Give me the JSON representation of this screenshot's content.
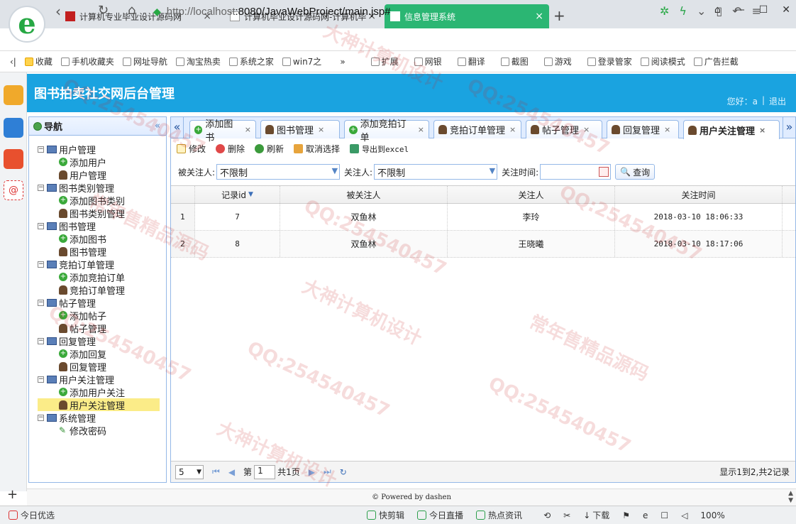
{
  "browser": {
    "tabs": [
      {
        "title": "计算机专业毕业设计源码网"
      },
      {
        "title": "计算机毕业设计源码网-计算机毕"
      },
      {
        "title": "信息管理系统"
      }
    ],
    "new_tab": "+",
    "url_host": "http://localhost",
    "url_path": ":8080/JavaWebProject/main.jsp#",
    "bookmarks": [
      "收藏",
      "手机收藏夹",
      "网址导航",
      "淘宝热卖",
      "系统之家",
      "win7之",
      "扩展",
      "网银",
      "翻译",
      "截图",
      "游戏",
      "登录管家",
      "阅读模式",
      "广告拦截"
    ],
    "status": [
      "今日优选",
      "快剪辑",
      "今日直播",
      "热点资讯",
      "下载",
      "100%"
    ]
  },
  "app": {
    "title": "图书拍卖社交网后台管理",
    "greeting": "您好：a",
    "separator": "|",
    "logout": "退出"
  },
  "nav": {
    "title": "导航",
    "groups": [
      {
        "label": "用户管理",
        "children": [
          "添加用户",
          "用户管理"
        ]
      },
      {
        "label": "图书类别管理",
        "children": [
          "添加图书类别",
          "图书类别管理"
        ]
      },
      {
        "label": "图书管理",
        "children": [
          "添加图书",
          "图书管理"
        ]
      },
      {
        "label": "竞拍订单管理",
        "children": [
          "添加竞拍订单",
          "竞拍订单管理"
        ]
      },
      {
        "label": "帖子管理",
        "children": [
          "添加帖子",
          "帖子管理"
        ]
      },
      {
        "label": "回复管理",
        "children": [
          "添加回复",
          "回复管理"
        ]
      },
      {
        "label": "用户关注管理",
        "children": [
          "添加用户关注",
          "用户关注管理"
        ]
      },
      {
        "label": "系统管理",
        "children": [
          "修改密码"
        ]
      }
    ]
  },
  "main": {
    "tabs": [
      "添加图书",
      "图书管理",
      "添加竞拍订单",
      "竞拍订单管理",
      "帖子管理",
      "回复管理",
      "用户关注管理"
    ],
    "toolbar": {
      "edit": "修改",
      "delete": "删除",
      "refresh": "刷新",
      "deselect": "取消选择",
      "export": "导出到excel"
    },
    "filter": {
      "followed_label": "被关注人:",
      "followed_value": "不限制",
      "follower_label": "关注人:",
      "follower_value": "不限制",
      "time_label": "关注时间:",
      "query": "查询"
    },
    "grid": {
      "headers": [
        "记录id",
        "被关注人",
        "关注人",
        "关注时间"
      ],
      "rows": [
        {
          "num": "1",
          "id": "7",
          "followed": "双鱼林",
          "follower": "李玲",
          "time": "2018-03-10 18:06:33"
        },
        {
          "num": "2",
          "id": "8",
          "followed": "双鱼林",
          "follower": "王晓曦",
          "time": "2018-03-10 18:17:06"
        }
      ]
    },
    "pager": {
      "page_size": "5",
      "page_prefix": "第",
      "page_value": "1",
      "page_suffix": "共1页",
      "summary": "显示1到2,共2记录"
    }
  },
  "footer": {
    "text": "© Powered by dashen"
  },
  "watermarks": [
    "QQ:254540457",
    "大神计算机设计",
    "常年售精品源码"
  ]
}
